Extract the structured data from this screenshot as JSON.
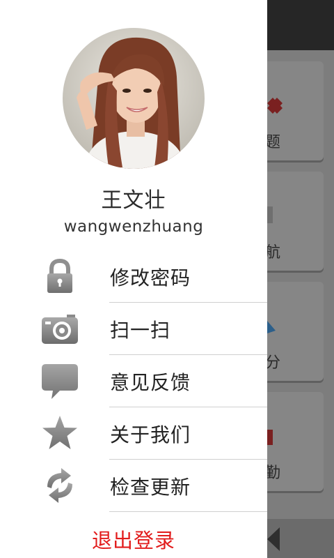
{
  "user": {
    "name": "王文壮",
    "id": "wangwenzhuang"
  },
  "menu": [
    {
      "label": "修改密码",
      "icon": "lock-icon"
    },
    {
      "label": "扫一扫",
      "icon": "camera-icon"
    },
    {
      "label": "意见反馈",
      "icon": "chat-bubble-icon"
    },
    {
      "label": "关于我们",
      "icon": "star-icon"
    },
    {
      "label": "检查更新",
      "icon": "refresh-icon"
    }
  ],
  "logout_label": "退出登录",
  "background_app": {
    "cards": [
      "题",
      "航",
      "分",
      "勤"
    ]
  },
  "colors": {
    "logout": "#e21c1c",
    "icon_gray": "#8a8a8a",
    "overlay_dim": "#7d7d7d"
  }
}
